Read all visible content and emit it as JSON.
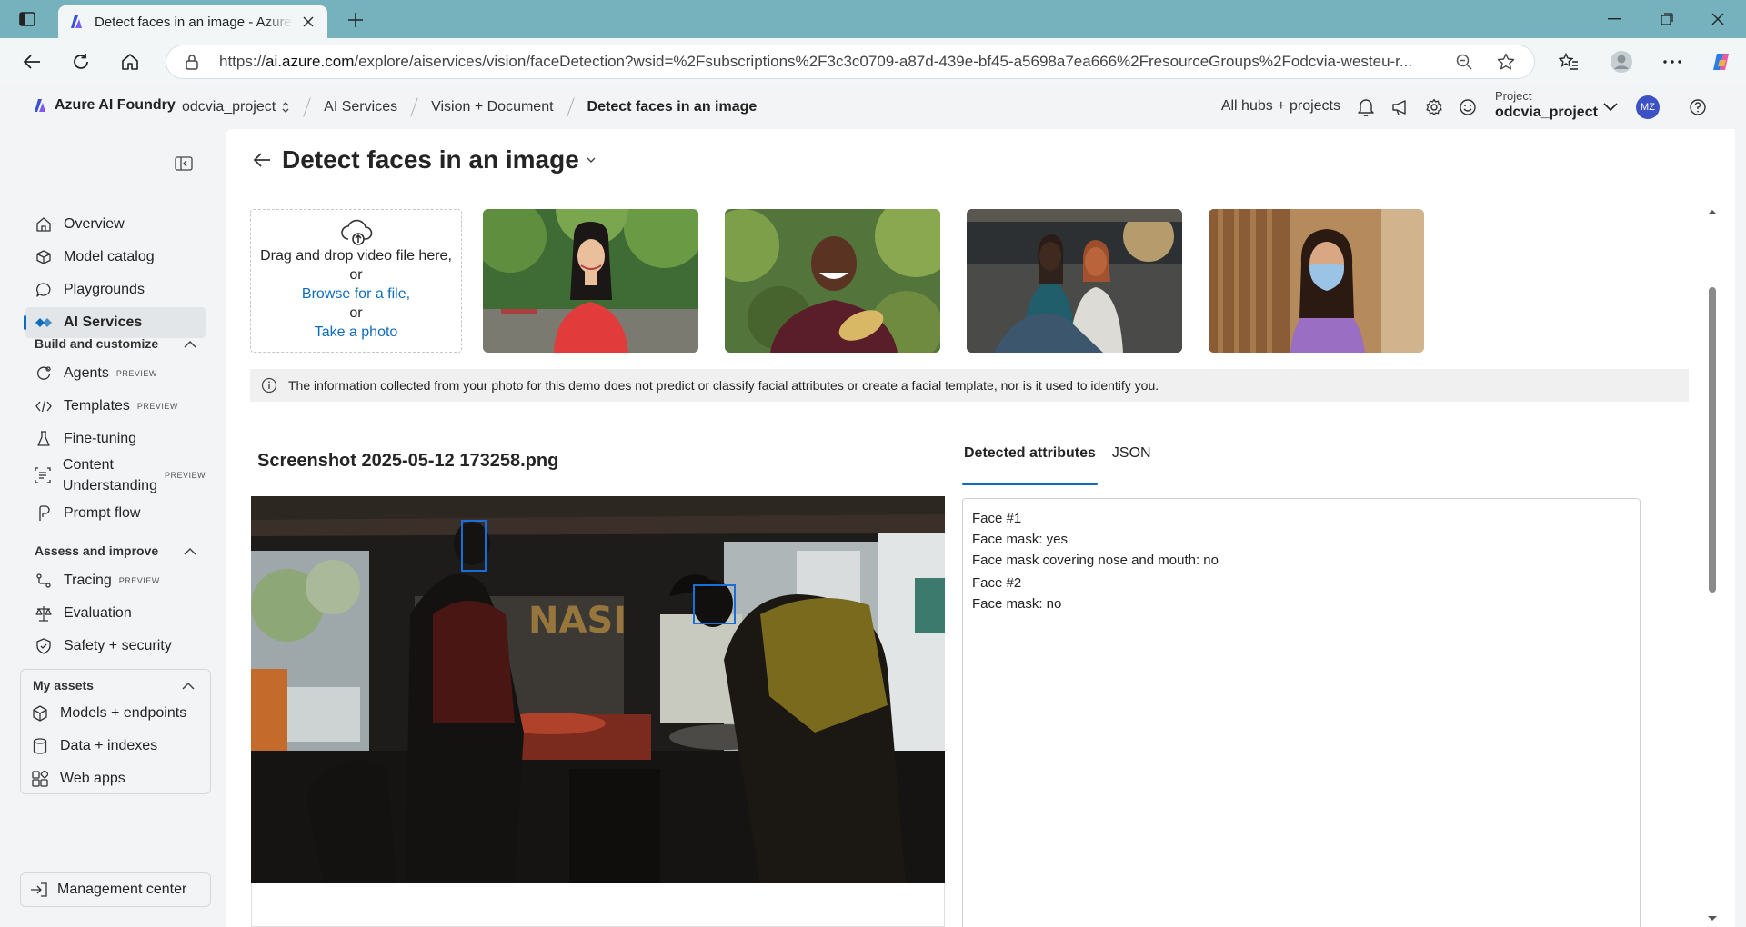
{
  "browser": {
    "tab_title": "Detect faces in an image - Azure AI Foundry",
    "url_prefix": "https://",
    "url_host": "ai.azure.com",
    "url_rest": "/explore/aiservices/vision/faceDetection?wsid=%2Fsubscriptions%2F3c3c0709-a87d-439e-bf45-a5698a7ea666%2FresourceGroups%2Fodcvia-westeu-r..."
  },
  "header": {
    "brand": "Azure AI Foundry",
    "breadcrumbs": [
      "odcvia_project",
      "AI Services",
      "Vision + Document",
      "Detect faces in an image"
    ],
    "all_hubs": "All hubs + projects",
    "project_label": "Project",
    "project_name": "odcvia_project",
    "avatar_initials": "MZ"
  },
  "sidebar": {
    "items": [
      {
        "label": "Overview",
        "icon": "home-icon"
      },
      {
        "label": "Model catalog",
        "icon": "cube-stack-icon"
      },
      {
        "label": "Playgrounds",
        "icon": "chat-icon"
      },
      {
        "label": "AI Services",
        "icon": "ai-services-icon"
      }
    ],
    "build_header": "Build and customize",
    "build_items": [
      {
        "label": "Agents",
        "badge": "PREVIEW"
      },
      {
        "label": "Templates",
        "badge": "PREVIEW"
      },
      {
        "label": "Fine-tuning",
        "badge": ""
      },
      {
        "label_1": "Content",
        "label_2": "Understanding",
        "badge": "PREVIEW"
      },
      {
        "label": "Prompt flow",
        "badge": ""
      }
    ],
    "assess_header": "Assess and improve",
    "assess_items": [
      {
        "label": "Tracing",
        "badge": "PREVIEW"
      },
      {
        "label": "Evaluation",
        "badge": ""
      },
      {
        "label": "Safety + security",
        "badge": ""
      }
    ],
    "assets_header": "My assets",
    "assets_items": [
      {
        "label": "Models + endpoints"
      },
      {
        "label": "Data + indexes"
      },
      {
        "label": "Web apps"
      }
    ],
    "management": "Management center"
  },
  "main": {
    "title": "Detect faces in an image",
    "dropzone": {
      "line1": "Drag and drop video file here,",
      "or1": "or",
      "browse": "Browse for a file,",
      "or2": "or",
      "photo": "Take a photo"
    },
    "info": "The information collected from your photo for this demo does not predict or classify facial attributes or create a facial template, nor is it used to identify you.",
    "file_name": "Screenshot 2025-05-12 173258.png",
    "tabs": [
      "Detected attributes",
      "JSON"
    ],
    "faces": [
      {
        "title": "Face #1",
        "lines": [
          "Face mask: yes",
          "Face mask covering nose and mouth: no"
        ]
      },
      {
        "title": "Face #2",
        "lines": [
          "Face mask: no"
        ]
      }
    ]
  },
  "colors": {
    "accent": "#0f6cbd",
    "chrome": "#76b2bd",
    "face_box": "#1a6ed8"
  }
}
